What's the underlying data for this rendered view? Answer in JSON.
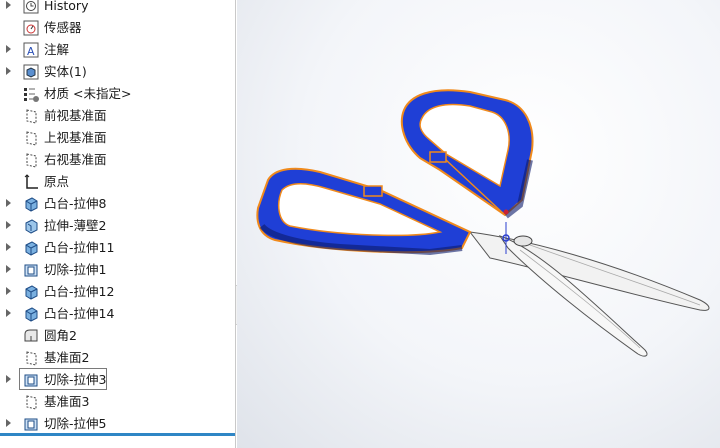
{
  "tree": {
    "items": [
      {
        "label": "History",
        "icon": "history-icon",
        "expandable": true
      },
      {
        "label": "传感器",
        "icon": "sensor-icon",
        "expandable": false
      },
      {
        "label": "注解",
        "icon": "annotation-icon",
        "expandable": true
      },
      {
        "label": "实体(1)",
        "icon": "solid-bodies-icon",
        "expandable": true
      },
      {
        "label": "材质 <未指定>",
        "icon": "material-icon",
        "expandable": false
      },
      {
        "label": "前视基准面",
        "icon": "plane-icon",
        "expandable": false
      },
      {
        "label": "上视基准面",
        "icon": "plane-icon",
        "expandable": false
      },
      {
        "label": "右视基准面",
        "icon": "plane-icon",
        "expandable": false
      },
      {
        "label": "原点",
        "icon": "origin-icon",
        "expandable": false
      },
      {
        "label": "凸台-拉伸8",
        "icon": "boss-extrude-icon",
        "expandable": true
      },
      {
        "label": "拉伸-薄壁2",
        "icon": "thin-extrude-icon",
        "expandable": true
      },
      {
        "label": "凸台-拉伸11",
        "icon": "boss-extrude-icon",
        "expandable": true
      },
      {
        "label": "切除-拉伸1",
        "icon": "cut-extrude-icon",
        "expandable": true
      },
      {
        "label": "凸台-拉伸12",
        "icon": "boss-extrude-icon",
        "expandable": true
      },
      {
        "label": "凸台-拉伸14",
        "icon": "boss-extrude-icon",
        "expandable": true
      },
      {
        "label": "圆角2",
        "icon": "fillet-icon",
        "expandable": false
      },
      {
        "label": "基准面2",
        "icon": "plane-icon",
        "expandable": false
      },
      {
        "label": "切除-拉伸3",
        "icon": "cut-extrude-icon",
        "expandable": true,
        "selected": true
      },
      {
        "label": "基准面3",
        "icon": "plane-icon",
        "expandable": false
      },
      {
        "label": "切除-拉伸5",
        "icon": "cut-extrude-icon",
        "expandable": true
      }
    ]
  },
  "colors": {
    "handle": "#1f3fd6",
    "edge_highlight": "#f08a1c",
    "blade": "#f4f4f4",
    "rollback_bar": "#2f86c5"
  },
  "viewport": {
    "model": "scissors-3d-model"
  }
}
